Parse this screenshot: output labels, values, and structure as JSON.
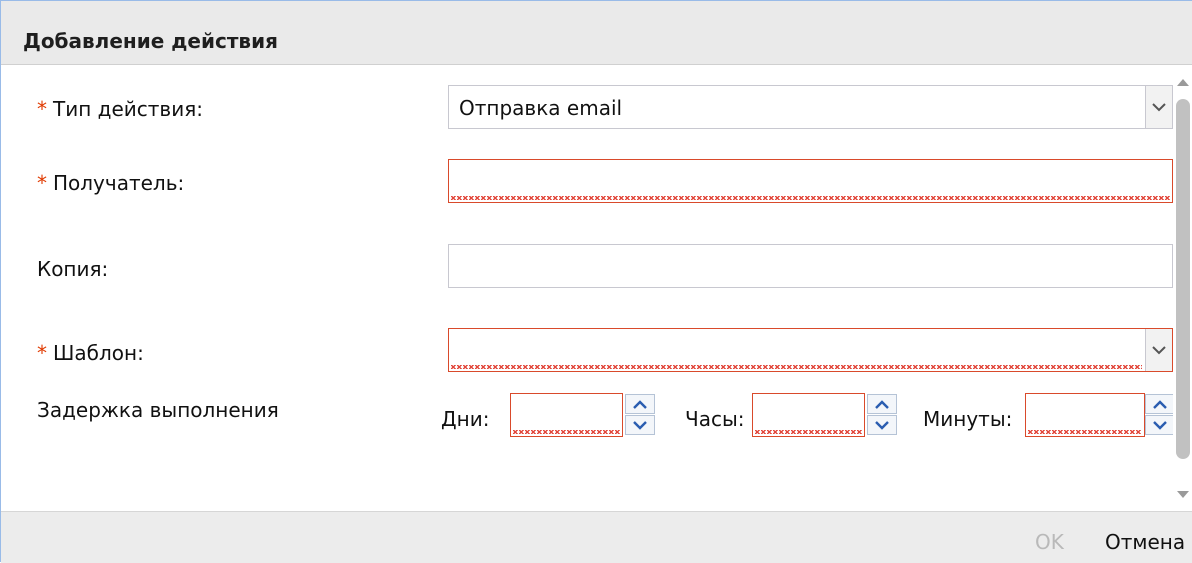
{
  "dialog": {
    "title": "Добавление действия"
  },
  "form": {
    "required_mark": "*",
    "action_type": {
      "label": "Тип действия:",
      "value": "Отправка email"
    },
    "recipient": {
      "label": "Получатель:",
      "value": ""
    },
    "copy": {
      "label": "Копия:",
      "value": ""
    },
    "template": {
      "label": "Шаблон:",
      "value": ""
    },
    "delay": {
      "label": "Задержка выполнения",
      "days_label": "Дни:",
      "hours_label": "Часы:",
      "minutes_label": "Минуты:",
      "days_value": "",
      "hours_value": "",
      "minutes_value": ""
    }
  },
  "footer": {
    "ok_label": "OK",
    "cancel_label": "Отмена"
  },
  "colors": {
    "required": "#e03a00",
    "invalid_border": "#d94a2b",
    "disabled_text": "#b9b9b9"
  },
  "icons": {
    "combo_trigger": "chevron-down-icon",
    "spinner": "spinner-up-down-icon"
  }
}
